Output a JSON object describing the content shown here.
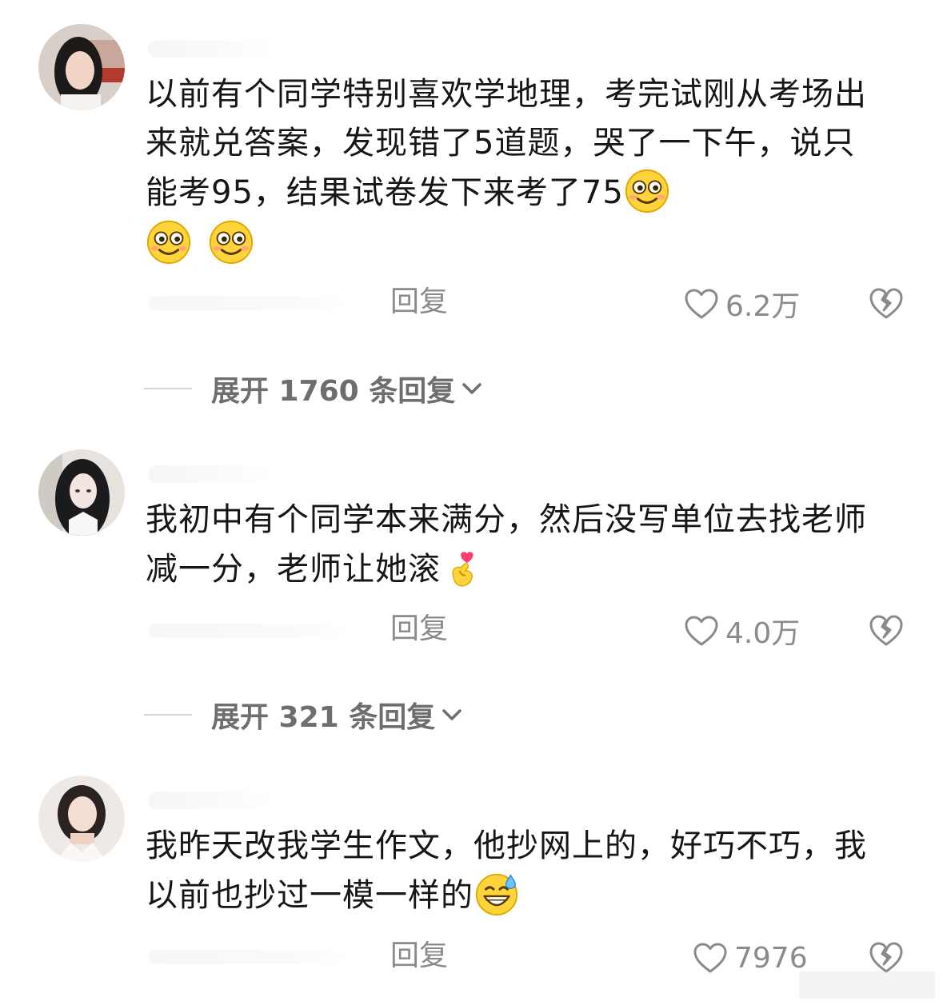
{
  "comments": [
    {
      "text": "以前有个同学特别喜欢学地理，考完试刚从考场出来就兑答案，发现错了5道题，哭了一下午，说只能考95，结果试卷发下来考了75",
      "emojis_inline": [
        "smile-emoji"
      ],
      "emojis_trailing": [
        "smile-emoji",
        "smile-emoji"
      ],
      "reply_label": "回复",
      "like_count": "6.2万",
      "expand_label": "展开 1760 条回复"
    },
    {
      "text": "我初中有个同学本来满分，然后没写单位去找老师减一分，老师让她滚",
      "emojis_inline": [
        "finger-heart-emoji"
      ],
      "reply_label": "回复",
      "like_count": "4.0万",
      "expand_label": "展开 321 条回复"
    },
    {
      "text": "我昨天改我学生作文，他抄网上的，好巧不巧，我以前也抄过一模一样的",
      "emojis_inline": [
        "grin-sweat-emoji"
      ],
      "reply_label": "回复",
      "like_count": "7976"
    }
  ],
  "colors": {
    "text": "#161616",
    "muted": "#8a8a8a",
    "expand": "#6e6e6e",
    "emoji_yellow": "#ffd43b"
  }
}
